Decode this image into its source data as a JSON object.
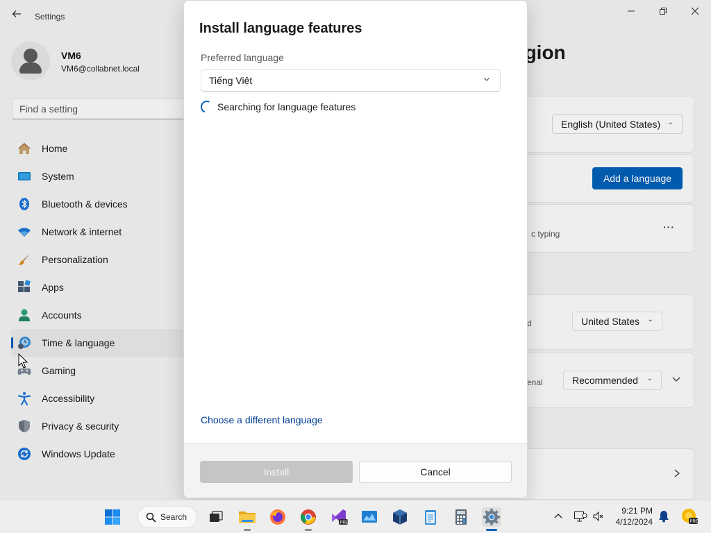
{
  "settings": {
    "app_title": "Settings",
    "profile": {
      "name": "VM6",
      "email": "VM6@collabnet.local"
    },
    "search_placeholder": "Find a setting",
    "nav": [
      {
        "label": "Home",
        "icon": "home-icon"
      },
      {
        "label": "System",
        "icon": "system-icon"
      },
      {
        "label": "Bluetooth & devices",
        "icon": "bluetooth-icon"
      },
      {
        "label": "Network & internet",
        "icon": "network-icon"
      },
      {
        "label": "Personalization",
        "icon": "brush-icon"
      },
      {
        "label": "Apps",
        "icon": "apps-icon"
      },
      {
        "label": "Accounts",
        "icon": "accounts-icon"
      },
      {
        "label": "Time & language",
        "icon": "time-language-icon",
        "selected": true
      },
      {
        "label": "Gaming",
        "icon": "gaming-icon"
      },
      {
        "label": "Accessibility",
        "icon": "accessibility-icon"
      },
      {
        "label": "Privacy & security",
        "icon": "shield-icon"
      },
      {
        "label": "Windows Update",
        "icon": "windows-update-icon"
      }
    ],
    "page_title_fragment": "egion",
    "display_language_value": "English (United States)",
    "add_language_label": "Add a language",
    "typing_fragment": "c typing",
    "more_label": "···",
    "region_fragment": "d",
    "region_value": "United States",
    "format_fragment": "enal",
    "format_value": "Recommended"
  },
  "dialog": {
    "title": "Install language features",
    "preferred_language_label": "Preferred language",
    "preferred_language_value": "Tiếng Việt",
    "status_text": "Searching for language features",
    "choose_different_link": "Choose a different language",
    "install_label": "Install",
    "cancel_label": "Cancel"
  },
  "taskbar": {
    "search_label": "Search",
    "time": "9:21 PM",
    "date": "4/12/2024"
  },
  "colors": {
    "accent": "#005fb8",
    "link": "#003e92"
  }
}
